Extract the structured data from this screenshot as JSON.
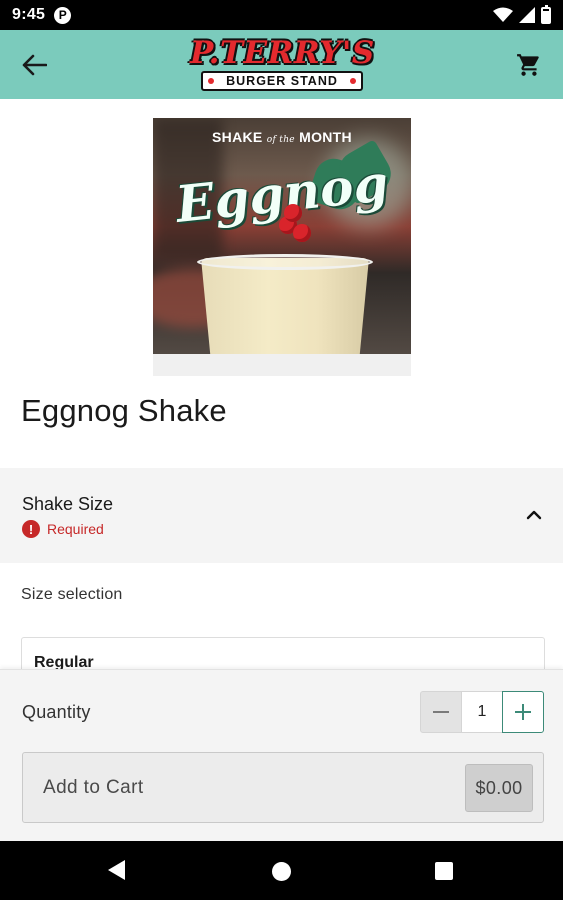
{
  "status_bar": {
    "time": "9:45",
    "app_icon_letter": "P",
    "icons": [
      "wifi-icon",
      "signal-icon",
      "battery-icon"
    ]
  },
  "app_bar": {
    "logo_top": "P.TERRY'S",
    "logo_bottom": "BURGER STAND",
    "icons": [
      "back-arrow-icon",
      "shopping-cart-icon"
    ]
  },
  "product_image": {
    "heading_left": "SHAKE",
    "heading_mid": "of the",
    "heading_right": "MONTH",
    "script_text": "Eggnog"
  },
  "product": {
    "title": "Eggnog Shake"
  },
  "options_section": {
    "title": "Shake Size",
    "required_text": "Required",
    "required_icon": "!",
    "collapse_icon": "chevron-up-icon",
    "selection_label": "Size selection",
    "options": [
      {
        "label": "Regular"
      }
    ]
  },
  "order_panel": {
    "quantity_label": "Quantity",
    "quantity_value": "1",
    "add_to_cart_label": "Add to Cart",
    "price": "$0.00"
  },
  "colors": {
    "app_bar": "#7bcbbc",
    "brand_red": "#e32a2e",
    "required_red": "#c62828",
    "accent_green": "#3c8a78"
  }
}
